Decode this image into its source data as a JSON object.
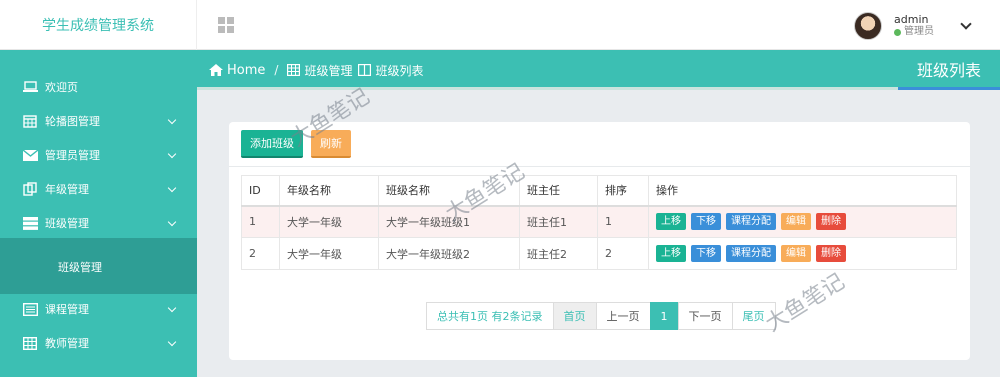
{
  "app": {
    "title": "学生成绩管理系统"
  },
  "user": {
    "name": "admin",
    "role": "管理员"
  },
  "sidebar": {
    "items": [
      {
        "label": "欢迎页",
        "icon": "laptop-icon"
      },
      {
        "label": "轮播图管理",
        "icon": "calendar-icon"
      },
      {
        "label": "管理员管理",
        "icon": "envelope-icon"
      },
      {
        "label": "年级管理",
        "icon": "copy-icon"
      },
      {
        "label": "班级管理",
        "icon": "server-icon"
      },
      {
        "label": "课程管理",
        "icon": "list-alt-icon"
      },
      {
        "label": "教师管理",
        "icon": "table-icon"
      }
    ],
    "submenu": {
      "label": "班级管理"
    }
  },
  "breadcrumb": {
    "home": "Home",
    "separator": "/",
    "level1": "班级管理",
    "level2": "班级列表"
  },
  "page": {
    "heading": "班级列表"
  },
  "toolbar": {
    "add_label": "添加班级",
    "refresh_label": "刷新"
  },
  "table": {
    "headers": [
      "ID",
      "年级名称",
      "班级名称",
      "班主任",
      "排序",
      "操作"
    ],
    "rows": [
      {
        "id": "1",
        "grade": "大学一年级",
        "class_name": "大学一年级班级1",
        "teacher": "班主任1",
        "order": "1"
      },
      {
        "id": "2",
        "grade": "大学一年级",
        "class_name": "大学一年级班级2",
        "teacher": "班主任2",
        "order": "2"
      }
    ],
    "actions": {
      "up": "上移",
      "down": "下移",
      "assign": "课程分配",
      "edit": "编辑",
      "delete": "删除"
    }
  },
  "pagination": {
    "info": "总共有1页  有2条记录",
    "first": "首页",
    "prev": "上一页",
    "current": "1",
    "next": "下一页",
    "last": "尾页"
  },
  "watermark": "大鱼笔记",
  "colors": {
    "teal": "#3cbfb3",
    "green": "#1ab394",
    "orange": "#f8ac59",
    "blue": "#3a8fd9",
    "red": "#e74c3c"
  }
}
